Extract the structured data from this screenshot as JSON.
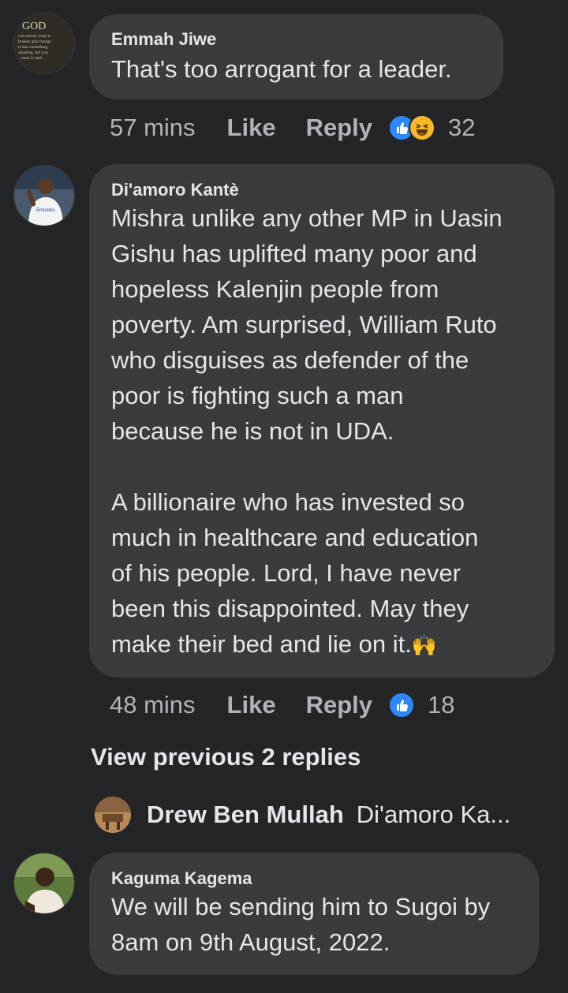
{
  "comments": [
    {
      "author": "Emmah Jiwe",
      "avatar_text": [
        "GOD",
        "can restore what is",
        "broken and change",
        "it into something",
        "amazing. All you",
        "need is faith."
      ],
      "text": "That's too arrogant for a leader.",
      "time": "57 mins",
      "like_label": "Like",
      "reply_label": "Reply",
      "reactions": [
        "like-icon",
        "haha-icon"
      ],
      "reaction_count": "32"
    },
    {
      "author": "Di'amoro Kantè",
      "avatar_jersey_text": "Emirates\nFLY",
      "text": "Mishra unlike any other MP in Uasin\nGishu has uplifted many poor and\nhopeless Kalenjin people from\npoverty. Am surprised, William Ruto\nwho disguises as defender of the\npoor is fighting such a man\nbecause he is not in UDA.\n\nA billionaire who has invested so\nmuch in healthcare and education\nof his people. Lord, I have never\nbeen this disappointed. May they\nmake their bed and lie on it.",
      "emoji": "🙌",
      "time": "48 mins",
      "like_label": "Like",
      "reply_label": "Reply",
      "reactions": [
        "like-icon"
      ],
      "reaction_count": "18"
    },
    {
      "author": "Kaguma Kagema",
      "text": "We will be sending him to Sugoi by\n8am on 9th August, 2022."
    }
  ],
  "view_previous_label": "View previous 2 replies",
  "reply_preview": {
    "name": "Drew Ben Mullah",
    "snippet": "Di'amoro Ka..."
  },
  "colors": {
    "background": "#242526",
    "bubble": "#3a3b3c",
    "primary_text": "#e4e6eb",
    "secondary_text": "#b0b3b8",
    "like_blue": "#2d88ff",
    "haha_yellow": "#f7b928"
  }
}
